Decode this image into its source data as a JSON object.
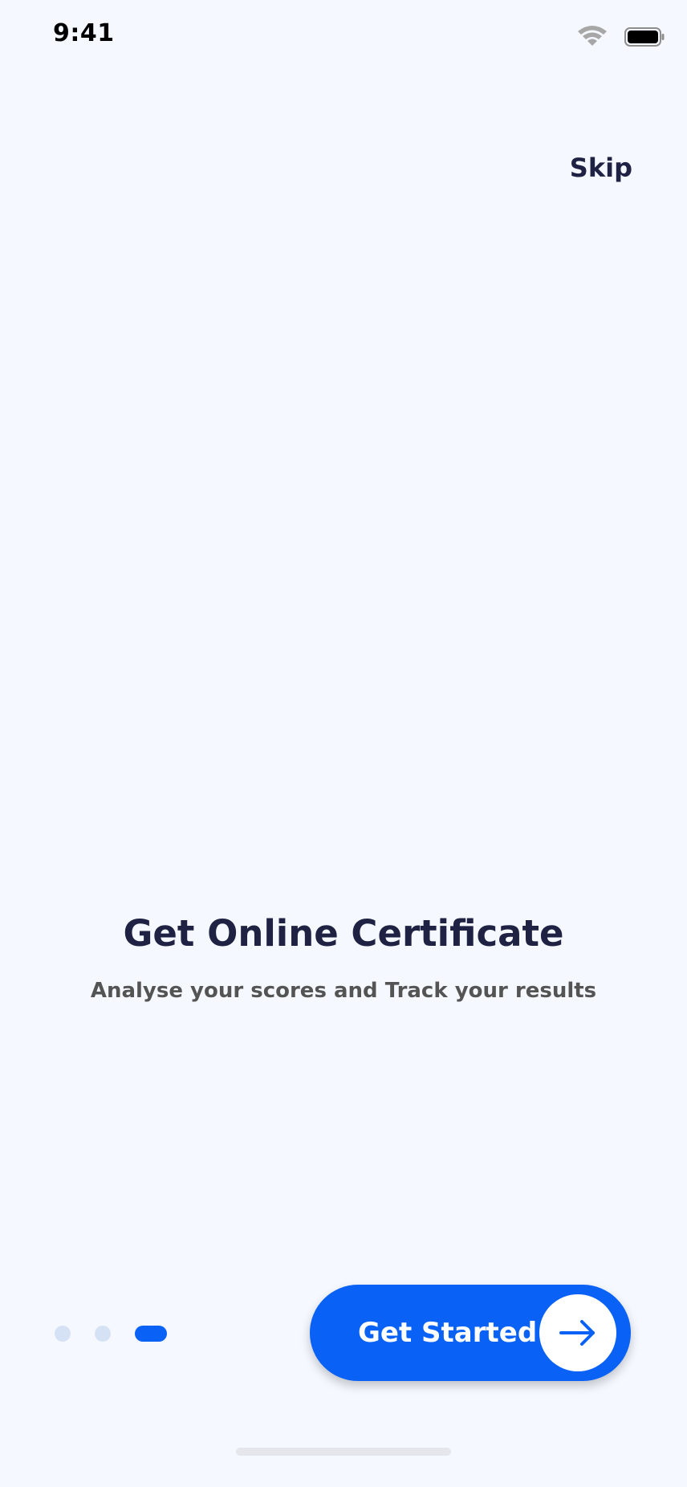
{
  "status_bar": {
    "time": "9:41",
    "wifi_icon": "wifi-icon",
    "battery_icon": "battery-icon"
  },
  "onboarding": {
    "skip_label": "Skip",
    "title": "Get Online Certificate",
    "subtitle": "Analyse your scores and Track your results",
    "pager": {
      "total_pages": 3,
      "current_page": 3
    },
    "cta": {
      "label": "Get Started",
      "icon": "arrow-right-icon"
    }
  },
  "colors": {
    "background": "#F5F9FF",
    "primary": "#0961F5",
    "heading": "#202244",
    "body_text": "#545454",
    "inactive_dot": "#D5E2F5"
  }
}
